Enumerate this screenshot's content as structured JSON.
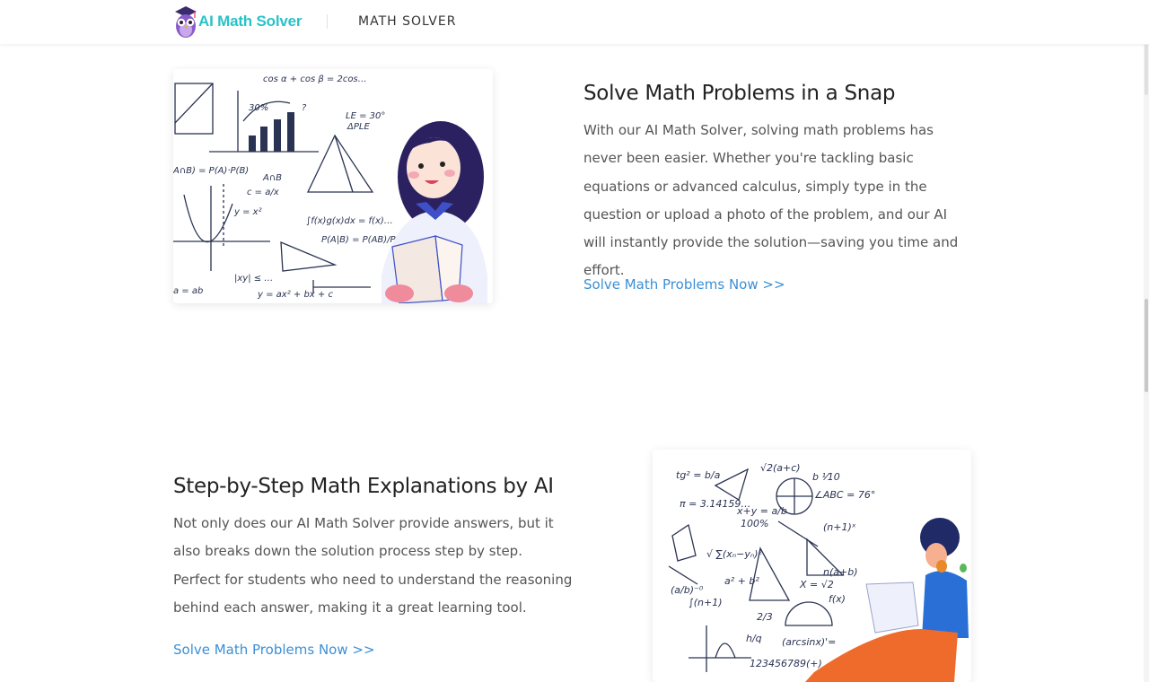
{
  "header": {
    "logo_text": "AI Math Solver",
    "nav_label": "MATH SOLVER"
  },
  "section1": {
    "title": "Solve Math Problems in a Snap",
    "body": "With our AI Math Solver, solving math problems has never been easier. Whether you're tackling basic equations or advanced calculus, simply type in the question or upload a photo of the problem, and our AI will instantly provide the solution—saving you time and effort.",
    "link": "Solve Math Problems Now >>"
  },
  "section2": {
    "title": "Step-by-Step Math Explanations by AI",
    "body": "Not only does our AI Math Solver provide answers, but it also breaks down the solution process step by step. Perfect for students who need to understand the reasoning behind each answer, making it a great learning tool.",
    "link": "Solve Math Problems Now >>"
  },
  "colors": {
    "brand": "#29c2c8",
    "link": "#3b8fd6",
    "title": "#222222",
    "body": "#555555"
  },
  "icons": {
    "logo": "owl-graduate-icon"
  }
}
